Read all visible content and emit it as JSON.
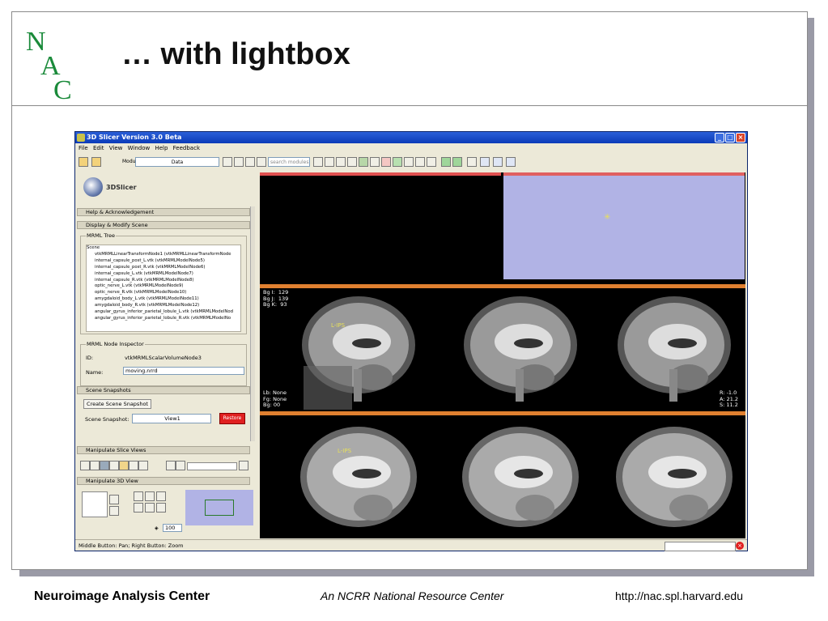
{
  "slide": {
    "title": "… with lightbox",
    "footer_left": "Neuroimage Analysis Center",
    "footer_center": "An NCRR National Resource Center",
    "footer_right": "http://nac.spl.harvard.edu",
    "logo_letters": [
      "N",
      "A",
      "C"
    ],
    "logo_color": "#1a8a3a"
  },
  "app": {
    "window_title": "3D Slicer Version 3.0 Beta",
    "menu": [
      "File",
      "Edit",
      "View",
      "Window",
      "Help",
      "Feedback"
    ],
    "modules_label": "Modules:",
    "module_value": "Data",
    "search_placeholder": "search modules",
    "brand": "3DSlicer",
    "sections": {
      "help": "Help & Acknowledgement",
      "display": "Display & Modify Scene",
      "snapshots": "Scene Snapshots",
      "slice_views": "Manipulate Slice Views",
      "view3d": "Manipulate 3D View"
    },
    "mrml_tree": {
      "title": "MRML Tree",
      "items": [
        "Scene",
        "vtkMRMLLinearTransformNode1 (vtkMRMLLinearTransformNode",
        "internal_capsule_post_L.vtk (vtkMRMLModelNode5)",
        "internal_capsule_post_R.vtk (vtkMRMLModelNode6)",
        "internal_capsule_L.vtk (vtkMRMLModelNode7)",
        "internal_capsule_R.vtk (vtkMRMLModelNode8)",
        "optic_nerve_L.vtk (vtkMRMLModelNode9)",
        "optic_nerve_R.vtk (vtkMRMLModelNode10)",
        "amygdaloid_body_L.vtk (vtkMRMLModelNode11)",
        "amygdaloid_body_R.vtk (vtkMRMLModelNode12)",
        "angular_gyrus_inferior_parietal_lobule_L.vtk (vtkMRMLModelNod",
        "angular_gyrus_inferior_parietal_lobule_R.vtk (vtkMRMLModelNo"
      ]
    },
    "node_inspector": {
      "title": "MRML Node Inspector",
      "id_label": "ID:",
      "id_value": "vtkMRMLScalarVolumeNode3",
      "name_label": "Name:",
      "name_value": "moving.nrrd"
    },
    "snapshot": {
      "create_button": "Create Scene Snapshot",
      "label": "Scene Snapshot:",
      "value": "View1",
      "restore_button": "Restore"
    },
    "zoom_value": "100",
    "status": "Middle Button: Pan; Right Button: Zoom",
    "viewer": {
      "yellow_overlay_top": "Bg I:  129\nBg J:  139\nBg K:  93",
      "yellow_overlay_bottom": "Lb: None\nFg: None\nBg: 00",
      "yellow_overlay_right": "R: -1.0\nA: 21.2\nS: 11.2",
      "annotation": "L-IPS"
    },
    "colors": {
      "title_bar": "#0b3bb8",
      "view3d_bg": "#b1b3e5",
      "yellow_bar": "#e08030",
      "red_bar": "#e05050",
      "restore": "#e02020"
    }
  }
}
